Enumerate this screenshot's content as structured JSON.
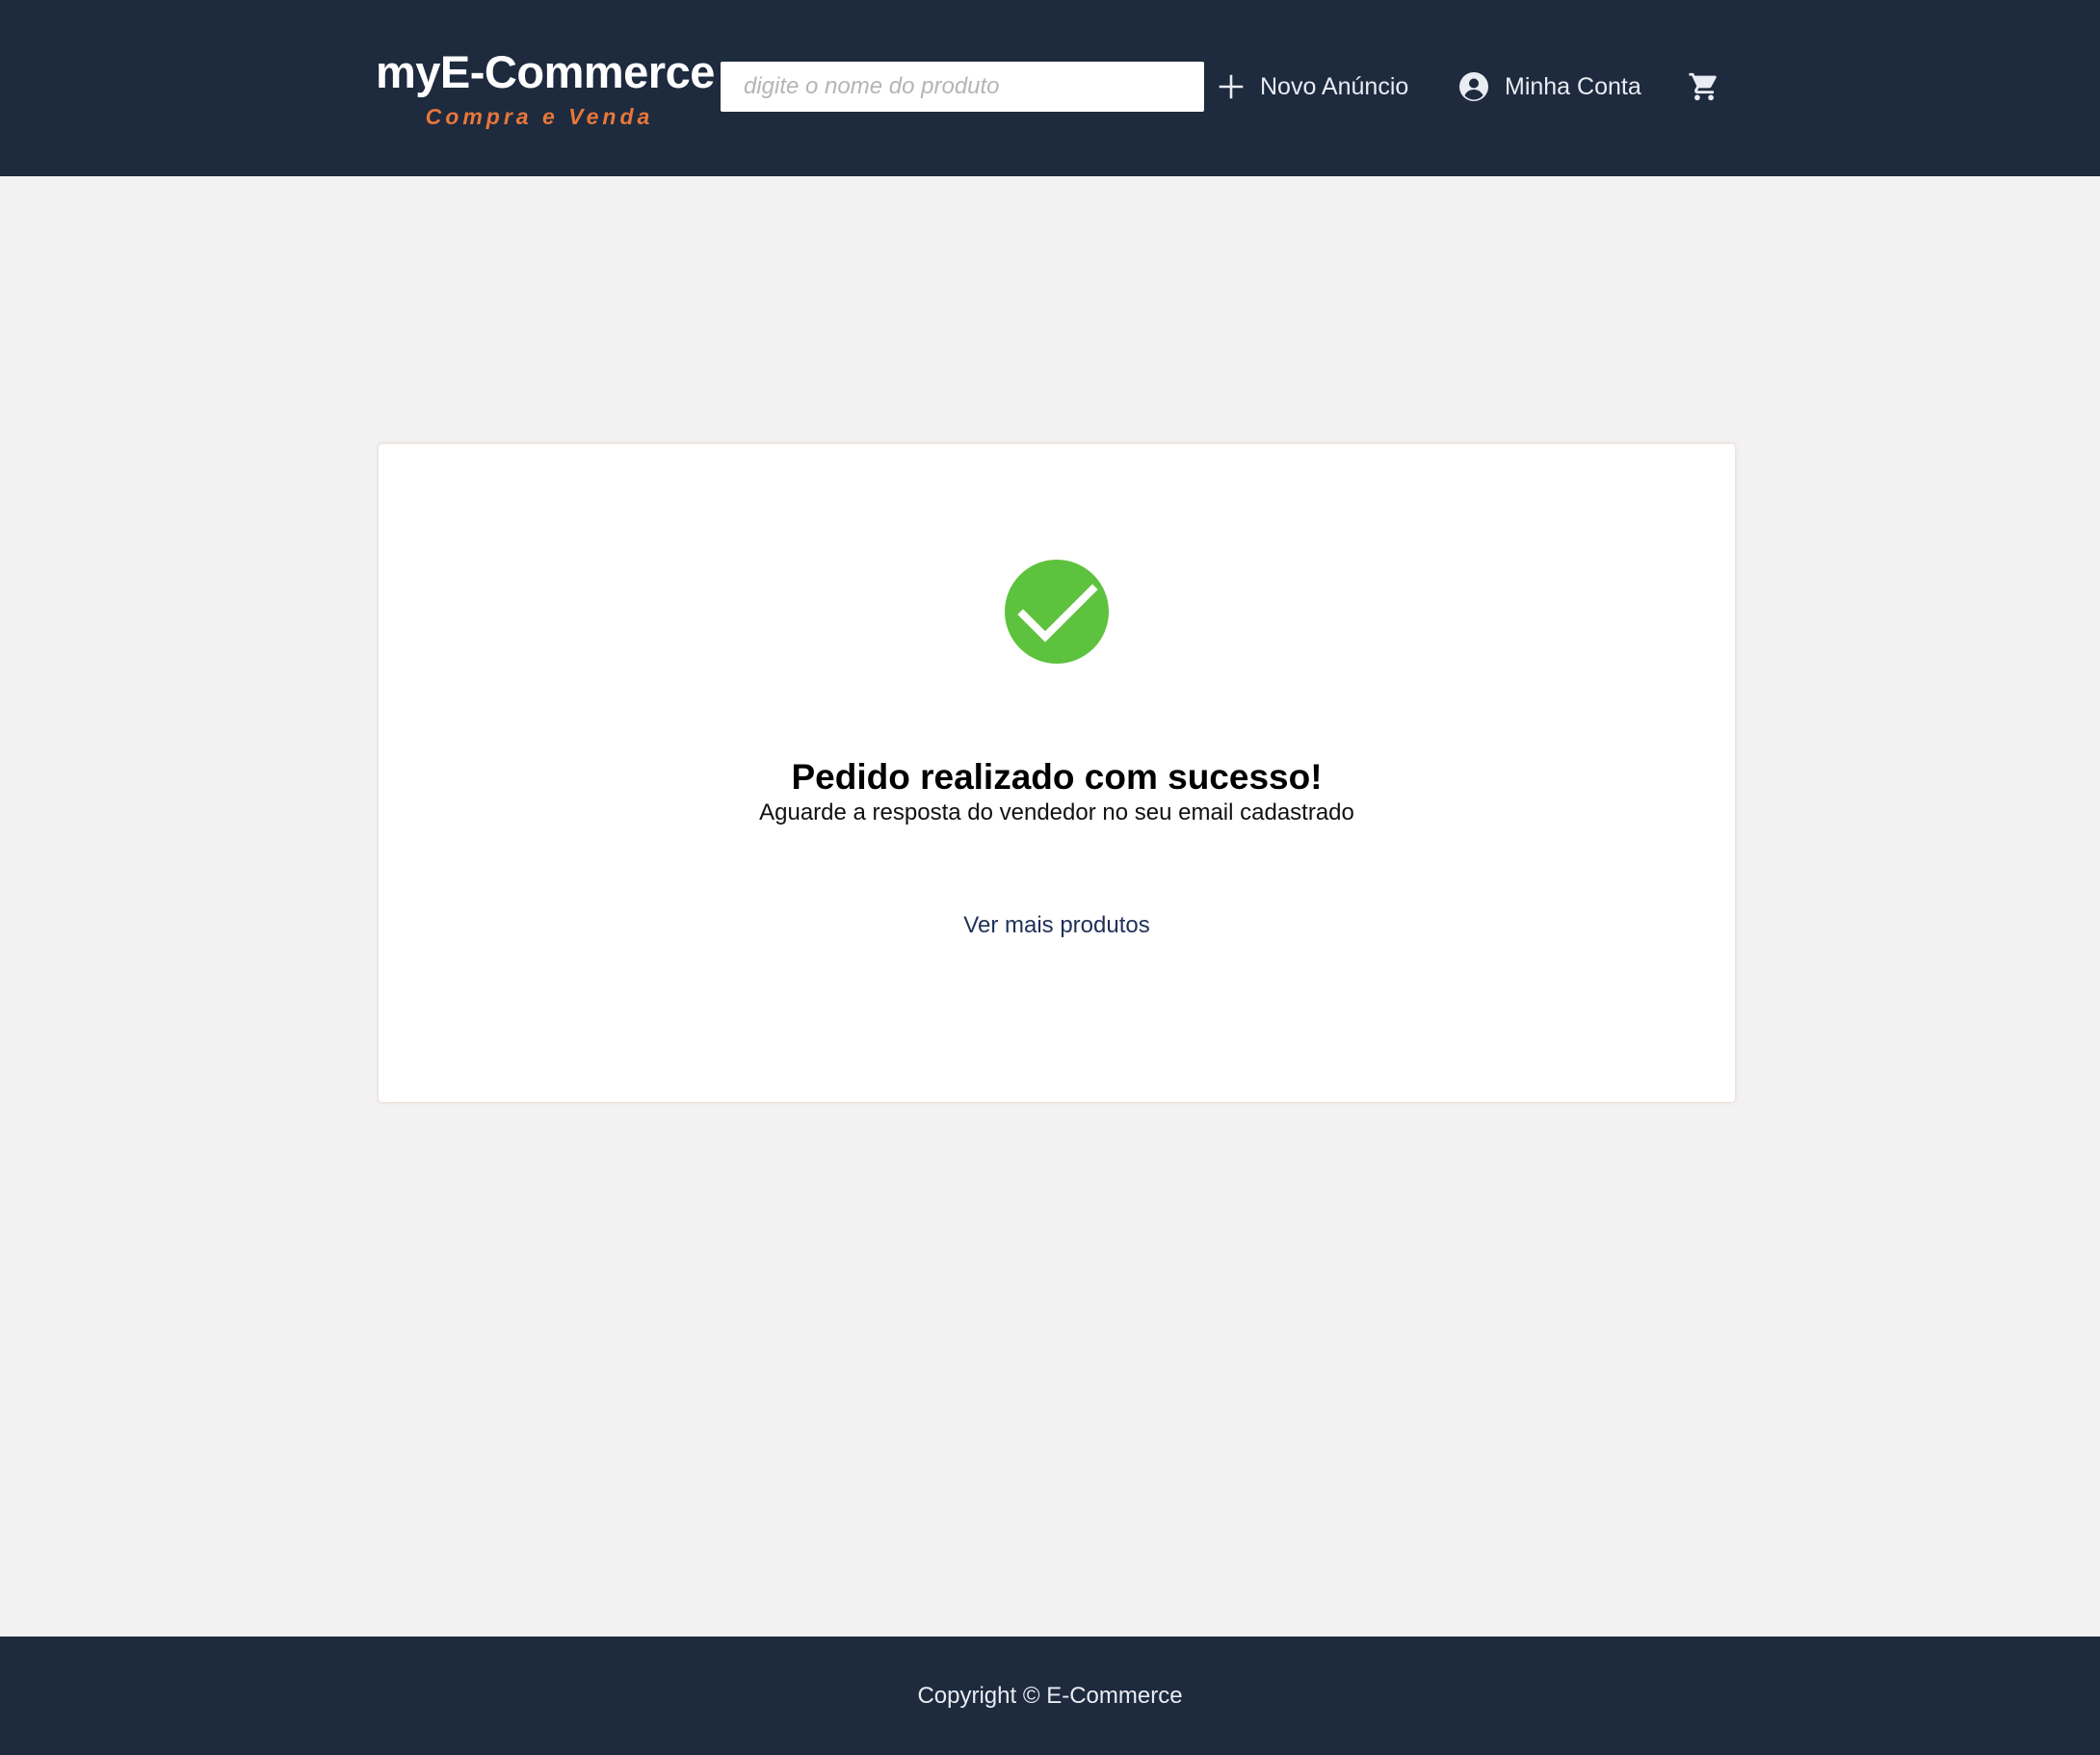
{
  "header": {
    "brand_title": "myE-Commerce",
    "brand_tagline": "Compra e Venda",
    "search": {
      "placeholder": "digite o nome do produto",
      "value": ""
    },
    "nav": {
      "new_listing": {
        "label": "Novo Anúncio",
        "icon": "plus-icon"
      },
      "account": {
        "label": "Minha Conta",
        "icon": "account-circle-icon"
      },
      "cart": {
        "icon": "cart-icon"
      }
    }
  },
  "main": {
    "status_icon": "check-circle-icon",
    "title": "Pedido realizado com sucesso!",
    "subtitle": "Aguarde a resposta do vendedor no seu email cadastrado",
    "link_label": "Ver mais produtos"
  },
  "footer": {
    "copyright": "Copyright © E-Commerce"
  },
  "colors": {
    "header_bg": "#1e2a3e",
    "page_bg": "#f2f2f2",
    "brand_accent": "#e8773a",
    "success": "#5dc23d",
    "link": "#1f3158"
  }
}
